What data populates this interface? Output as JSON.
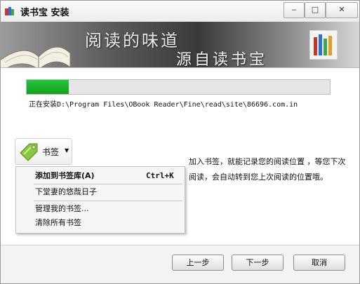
{
  "window": {
    "title": "读书宝 安装",
    "controls": {
      "minimize": "‒",
      "maximize": "□",
      "close": "✕"
    }
  },
  "banner": {
    "line1": "阅读的味道",
    "line2": "源自读书宝"
  },
  "progress": {
    "value": 0.14,
    "status_text": "正在安装D:\\Program Files\\OBook Reader\\Fine\\read\\site\\86696.com.in"
  },
  "bookmark": {
    "button_label": "书签",
    "menu": [
      {
        "label": "添加到书签库(A)",
        "shortcut": "Ctrl+K",
        "bold": true
      },
      {
        "label": "下堂妻的悠哉日子",
        "shortcut": ""
      },
      {
        "label": "管理我的书签...",
        "shortcut": ""
      },
      {
        "label": "清除所有书签",
        "shortcut": ""
      }
    ]
  },
  "description": "加入书签，就能记录您的阅读位置 ，等您下次阅读，会自动转到您上次阅读的位置哦。",
  "buttons": {
    "back": "上一步",
    "next": "下一步",
    "cancel": "取消"
  },
  "colors": {
    "progress_green": "#1cb32d",
    "window_bg": "#f3f3f3"
  }
}
